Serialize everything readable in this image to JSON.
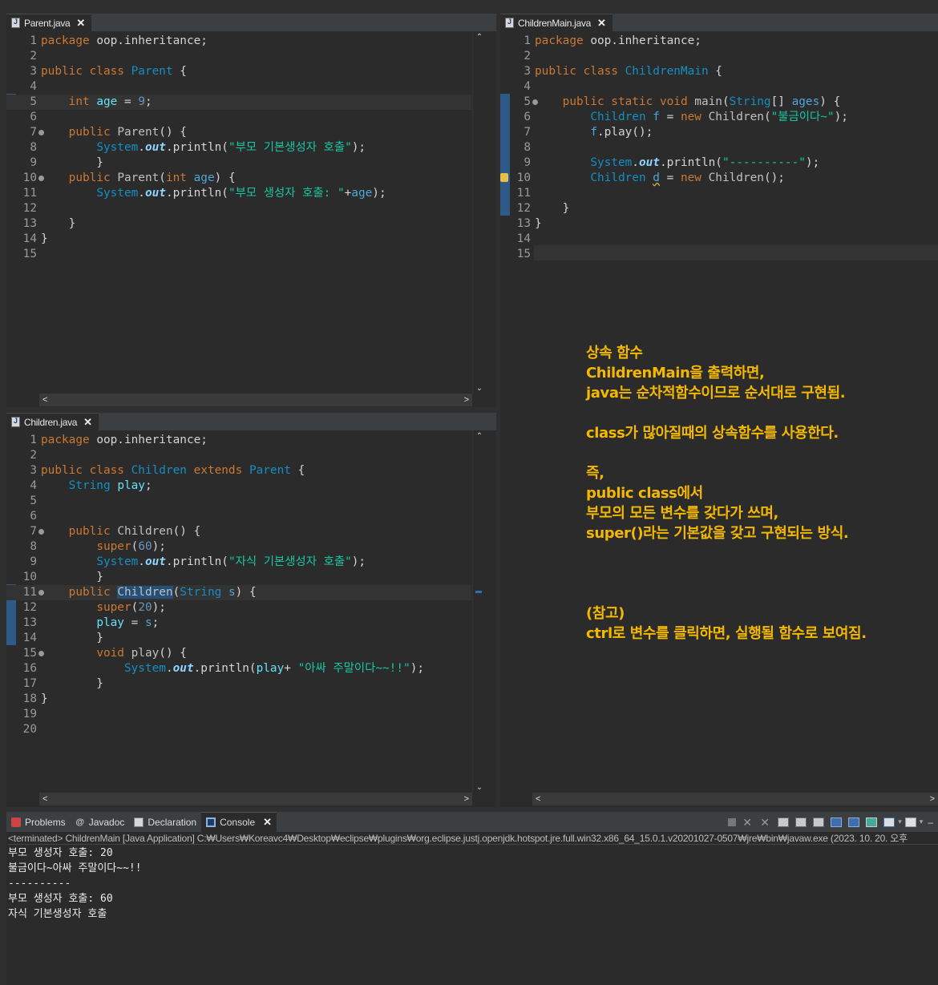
{
  "parent_editor": {
    "tab": "Parent.java",
    "lines": [
      {
        "n": "1",
        "html": "<span class='kw'>package</span><span class='df'> oop.inheritance;</span>"
      },
      {
        "n": "2",
        "html": ""
      },
      {
        "n": "3",
        "html": "<span class='kw'>public class </span><span class='cl'>Parent</span><span class='df'> {</span>"
      },
      {
        "n": "4",
        "html": ""
      },
      {
        "n": "5",
        "html": "<span class='df'>    </span><span class='kw'>int</span><span class='df'> </span><span class='fld'>age</span><span class='df'> = </span><span class='nm'>9</span><span class='df'>;</span>"
      },
      {
        "n": "6",
        "html": ""
      },
      {
        "n": "7",
        "html": "<span class='df'>    </span><span class='kw'>public </span><span class='fn'>Parent</span><span class='df'>() {</span>"
      },
      {
        "n": "8",
        "html": "<span class='df'>        </span><span class='cl'>System</span><span class='df'>.</span><span class='sf'>out</span><span class='df'>.println(</span><span class='st'>\"부모 기본생성자 호출\"</span><span class='df'>);</span>"
      },
      {
        "n": "9",
        "html": "<span class='df'>        }</span>"
      },
      {
        "n": "10",
        "html": "<span class='df'>    </span><span class='kw'>public </span><span class='fn'>Parent</span><span class='df'>(</span><span class='kw'>int</span><span class='df'> </span><span class='tp'>age</span><span class='df'>) {</span>"
      },
      {
        "n": "11",
        "html": "<span class='df'>        </span><span class='cl'>System</span><span class='df'>.</span><span class='sf'>out</span><span class='df'>.println(</span><span class='st'>\"부모 생성자 호출: \"</span><span class='df'>+</span><span class='tp'>age</span><span class='df'>);</span>"
      },
      {
        "n": "12",
        "html": ""
      },
      {
        "n": "13",
        "html": "<span class='df'>    }</span>"
      },
      {
        "n": "14",
        "html": "<span class='df'>}</span>"
      },
      {
        "n": "15",
        "html": ""
      }
    ]
  },
  "children_editor": {
    "tab": "Children.java",
    "lines": [
      {
        "n": "1",
        "html": "<span class='kw'>package</span><span class='df'> oop.inheritance;</span>"
      },
      {
        "n": "2",
        "html": ""
      },
      {
        "n": "3",
        "html": "<span class='kw'>public class </span><span class='cl'>Children</span><span class='kw'> extends </span><span class='cl'>Parent</span><span class='df'> {</span>"
      },
      {
        "n": "4",
        "html": "<span class='df'>    </span><span class='cl'>String</span><span class='df'> </span><span class='fld'>play</span><span class='df'>;</span>"
      },
      {
        "n": "5",
        "html": ""
      },
      {
        "n": "6",
        "html": ""
      },
      {
        "n": "7",
        "html": "<span class='df'>    </span><span class='kw'>public </span><span class='fn'>Children</span><span class='df'>() {</span>"
      },
      {
        "n": "8",
        "html": "<span class='df'>        </span><span class='kw'>super</span><span class='df'>(</span><span class='nm'>60</span><span class='df'>);</span>"
      },
      {
        "n": "9",
        "html": "<span class='df'>        </span><span class='cl'>System</span><span class='df'>.</span><span class='sf'>out</span><span class='df'>.println(</span><span class='st'>\"자식 기본생성자 호출\"</span><span class='df'>);</span>"
      },
      {
        "n": "10",
        "html": "<span class='df'>        }</span>"
      },
      {
        "n": "11",
        "html": "<span class='df'>    </span><span class='kw'>public </span><span class='fn sel'>Children</span><span class='df'>(</span><span class='cl'>String</span><span class='df'> </span><span class='tp'>s</span><span class='df'>) {</span>"
      },
      {
        "n": "12",
        "html": "<span class='df'>        </span><span class='kw'>super</span><span class='df'>(</span><span class='nm'>20</span><span class='df'>);</span>"
      },
      {
        "n": "13",
        "html": "<span class='df'>        </span><span class='fld'>play</span><span class='df'> = </span><span class='tp'>s</span><span class='df'>;</span>"
      },
      {
        "n": "14",
        "html": "<span class='df'>        }</span>"
      },
      {
        "n": "15",
        "html": "<span class='df'>        </span><span class='kw'>void </span><span class='fn'>play</span><span class='df'>() {</span>"
      },
      {
        "n": "16",
        "html": "<span class='df'>            </span><span class='cl'>System</span><span class='df'>.</span><span class='sf'>out</span><span class='df'>.println(</span><span class='fld'>play</span><span class='df'>+ </span><span class='st'>\"아싸 주말이다~~!!\"</span><span class='df'>);</span>"
      },
      {
        "n": "17",
        "html": "<span class='df'>        }</span>"
      },
      {
        "n": "18",
        "html": "<span class='df'>}</span>"
      },
      {
        "n": "19",
        "html": ""
      },
      {
        "n": "20",
        "html": ""
      }
    ]
  },
  "main_editor": {
    "tab": "ChildrenMain.java",
    "lines": [
      {
        "n": "1",
        "html": "<span class='kw'>package</span><span class='df'> oop.inheritance;</span>"
      },
      {
        "n": "2",
        "html": ""
      },
      {
        "n": "3",
        "html": "<span class='kw'>public class </span><span class='cl'>ChildrenMain</span><span class='df'> {</span>"
      },
      {
        "n": "4",
        "html": ""
      },
      {
        "n": "5",
        "html": "<span class='df'>    </span><span class='kw'>public static void </span><span class='fn'>main</span><span class='df'>(</span><span class='cl'>String</span><span class='df'>[] </span><span class='tp'>ages</span><span class='df'>) {</span>"
      },
      {
        "n": "6",
        "html": "<span class='df'>        </span><span class='cl'>Children</span><span class='df'> </span><span class='tp'>f</span><span class='df'> = </span><span class='kw'>new </span><span class='fn'>Children</span><span class='df'>(</span><span class='st'>\"불금이다~\"</span><span class='df'>);</span>"
      },
      {
        "n": "7",
        "html": "<span class='df'>        </span><span class='tp'>f</span><span class='df'>.play();</span>"
      },
      {
        "n": "8",
        "html": ""
      },
      {
        "n": "9",
        "html": "<span class='df'>        </span><span class='cl'>System</span><span class='df'>.</span><span class='sf'>out</span><span class='df'>.println(</span><span class='st'>\"----------\"</span><span class='df'>);</span>"
      },
      {
        "n": "10",
        "html": "<span class='df'>        </span><span class='cl'>Children</span><span class='df'> </span><span class='tp und'>d</span><span class='df'> = </span><span class='kw'>new </span><span class='fn'>Children</span><span class='df'>();</span>"
      },
      {
        "n": "11",
        "html": ""
      },
      {
        "n": "12",
        "html": "<span class='df'>    }</span>"
      },
      {
        "n": "13",
        "html": "<span class='df'>}</span>"
      },
      {
        "n": "14",
        "html": ""
      },
      {
        "n": "15",
        "html": ""
      }
    ]
  },
  "note": {
    "lines": [
      "상속 함수",
      "ChildrenMain을 출력하면,",
      "java는 순차적함수이므로 순서대로 구현됨.",
      "",
      "class가 많아질때의 상속함수를 사용한다.",
      "",
      "즉,",
      "public class에서",
      "부모의 모든 변수를 갖다가 쓰며,",
      "super()라는 기본값을 갖고 구현되는 방식.",
      "",
      "",
      "",
      "(참고)",
      "ctrl로 변수를 클릭하면, 실행될 함수로 보여짐."
    ]
  },
  "console": {
    "tabs": [
      "Problems",
      "Javadoc",
      "Declaration",
      "Console"
    ],
    "terminated": "<terminated> ChildrenMain [Java Application] C:₩Users₩Koreavc4₩Desktop₩eclipse₩plugins₩org.eclipse.justj.openjdk.hotspot.jre.full.win32.x86_64_15.0.1.v20201027-0507₩jre₩bin₩javaw.exe  (2023. 10. 20. 오후",
    "output": [
      "부모 생성자 호출: 20",
      "불금이다~아싸 주말이다~~!!",
      "----------",
      "부모 생성자 호출: 60",
      "자식 기본생성자 호출"
    ]
  }
}
